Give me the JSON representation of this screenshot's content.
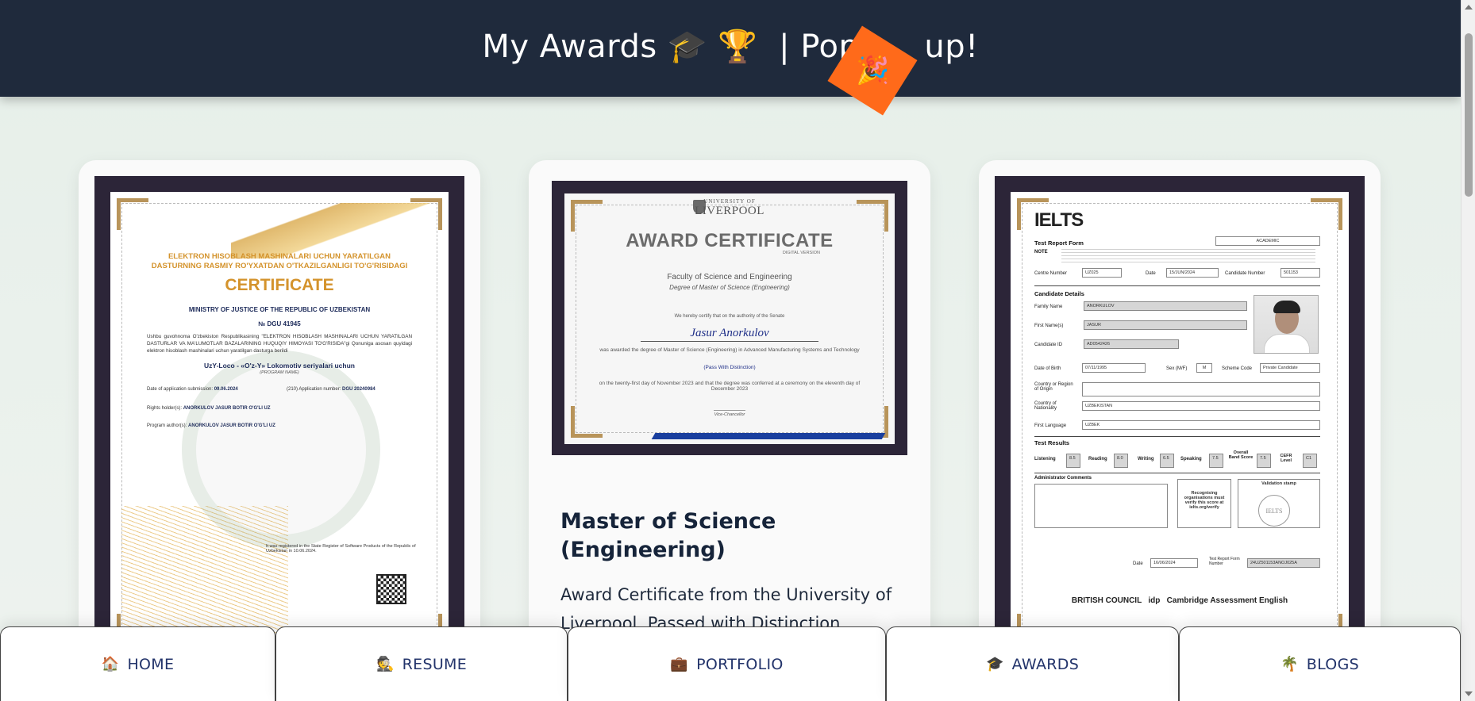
{
  "header": {
    "title": "My Awards 🎓 🏆  | Pop",
    "title_end": "up!",
    "party_icon": "🎉"
  },
  "cards": [
    {
      "id": "uz-software",
      "certificate": {
        "header_lines": [
          "ELEKTRON HISOBLASH MASHINALARI UCHUN YARATILGAN",
          "DASTURNING RASMIY RO'YXATDAN O'TKAZILGANLIGI TO'G'RISIDAGI"
        ],
        "title": "CERTIFICATE",
        "ministry": "MINISTRY OF JUSTICE OF THE REPUBLIC OF UZBEKISTAN",
        "number": "№ DGU 41945",
        "body": "Ushbu guvohnoma O'zbekiston Respublikasining \"ELEKTRON HISOBLASH MASHINALARI UCHUN YARATILGAN DASTURLAR VA MA'LUMOTLAR BAZALARINING HUQUQIY HIMOYASI TO'G'RISIDA\"gi Qonuniga asosan quyidagi elektron hisoblash mashinalari uchun yaratilgan dasturga berildi",
        "program_name": "UzY-Loco - «O'z-Y» Lokomotiv seriyalari uchun",
        "program_name_note": "(PROGRAM NAME)",
        "date_label": "Date of application submission:",
        "date_value": "09.06.2024",
        "appno_label": "(210) Application number:",
        "appno_value": "DGU 20240984",
        "rights_label": "Rights holder(s):",
        "rights_value": "ANORKULOV JASUR BOTIR O'G'LI UZ",
        "author_label": "Program author(s):",
        "author_value": "ANORKULOV JASUR BOTIR O'G'LI UZ",
        "registered": "It was registered in the State Register of Software Products of the Republic of Uzbekistan in 10.06.2024."
      }
    },
    {
      "id": "liverpool",
      "certificate": {
        "university_small": "UNIVERSITY OF",
        "university": "LIVERPOOL",
        "title": "AWARD CERTIFICATE",
        "digital": "DIGITAL VERSION",
        "faculty": "Faculty of Science and Engineering",
        "degree": "Degree of Master of Science (Engineering)",
        "certify": "We hereby certify that on the authority of the Senate",
        "name": "Jasur Anorkulov",
        "awarded": "was awarded the degree of Master of Science (Engineering) in Advanced Manufacturing Systems and Technology",
        "distinction": "(Pass With Distinction)",
        "conferred": "on the twenty-first day of November 2023 and that the degree was conferred at a ceremony on the eleventh day of December 2023",
        "vc": "Vice-Chancellor"
      },
      "title": "Master of Science (Engineering)",
      "description": "Award Certificate from the University of Liverpool. Passed with Distinction."
    },
    {
      "id": "ielts",
      "certificate": {
        "logo": "IELTS",
        "form": "Test Report Form",
        "module": "ACADEMIC",
        "note_label": "NOTE",
        "centre_label": "Centre Number",
        "centre": "UZ025",
        "date_label": "Date",
        "date": "15/JUN/2024",
        "cand_no_label": "Candidate Number",
        "cand_no": "501153",
        "details": "Candidate Details",
        "family_label": "Family Name",
        "family": "ANORKULOV",
        "first_label": "First Name(s)",
        "first": "JASUR",
        "id_label": "Candidate ID",
        "id": "AD0542426",
        "dob_label": "Date of Birth",
        "dob": "07/11/1995",
        "sex_label": "Sex (M/F)",
        "sex": "M",
        "scheme_label": "Scheme Code",
        "scheme": "Private Candidate",
        "origin_label": "Country or Region of Origin",
        "nationality_label": "Country of Nationality",
        "nationality": "UZBEKISTAN",
        "language_label": "First Language",
        "language": "UZBEK",
        "results": "Test Results",
        "scores": [
          {
            "label": "Listening",
            "value": "8.5"
          },
          {
            "label": "Reading",
            "value": "8.0"
          },
          {
            "label": "Writing",
            "value": "6.5"
          },
          {
            "label": "Speaking",
            "value": "7.5"
          },
          {
            "label": "Overall Band Score",
            "value": "7.5"
          },
          {
            "label": "CEFR Level",
            "value": "C1"
          }
        ],
        "admin": "Administrator Comments",
        "verify": "Recognising organisations must verify this score at ielts.org/verify",
        "validation": "Validation stamp",
        "issue_date_label": "Date",
        "issue_date": "16/06/2024",
        "trf_label": "Test Report Form Number",
        "trf": "24UZ501153ANOJ025A",
        "partners": "BRITISH COUNCIL   idp   Cambridge Assessment English"
      }
    }
  ],
  "nav": [
    {
      "icon": "🏠",
      "label": "HOME"
    },
    {
      "icon": "🕵️",
      "label": "RESUME"
    },
    {
      "icon": "💼",
      "label": "PORTFOLIO"
    },
    {
      "icon": "🎓",
      "label": "AWARDS"
    },
    {
      "icon": "🌴",
      "label": "BLOGS"
    }
  ]
}
